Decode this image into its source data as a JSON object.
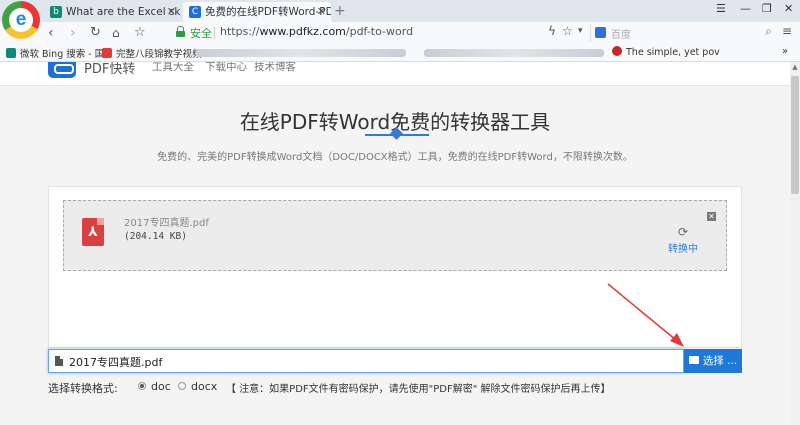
{
  "browser": {
    "logo_letter": "e",
    "tabs": [
      {
        "title": "What are the Excel skills? - 国际",
        "fav": "b"
      },
      {
        "title": "免费的在线PDF转Word-PDF在",
        "fav": "C"
      }
    ],
    "new_tab": "+",
    "window_controls": [
      "☰",
      "—",
      "❐",
      "✕"
    ],
    "secure_label": "安全",
    "url_scheme": "https://",
    "url_host": "www.pdfkz.com",
    "url_path": "/pdf-to-word",
    "search_placeholder": "百度",
    "bookmarks": [
      {
        "label": "微软 Bing 搜索 - 国",
        "color": "#0b8a77"
      },
      {
        "label": "完整八段锦教学视频",
        "color": "#e53935"
      },
      {
        "label": "The simple, yet pov",
        "color": "#c62828"
      }
    ]
  },
  "site": {
    "name": "PDF快转",
    "nav": [
      "工具大全",
      "下载中心",
      "技术博客"
    ]
  },
  "main": {
    "title": "在线PDF转Word免费的转换器工具",
    "subtitle": "免费的、完美的PDF转换成Word文档（DOC/DOCX格式）工具，免费的在线PDF转Word，不限转换次数。"
  },
  "upload": {
    "file_name": "2017专四真题.pdf",
    "file_size": "(204.14 KB)",
    "status": "转换中",
    "input_value": "2017专四真题.pdf",
    "choose_label": "选择 ..."
  },
  "format": {
    "label": "选择转换格式:",
    "options": [
      "doc",
      "docx"
    ],
    "selected": "doc",
    "notice": "【 注意：如果PDF文件有密码保护，请先使用\"PDF解密\" 解除文件密码保护后再上传】"
  },
  "colors": {
    "accent": "#1e78d7",
    "pdf_red": "#d94040",
    "arrow_red": "#e53935"
  }
}
